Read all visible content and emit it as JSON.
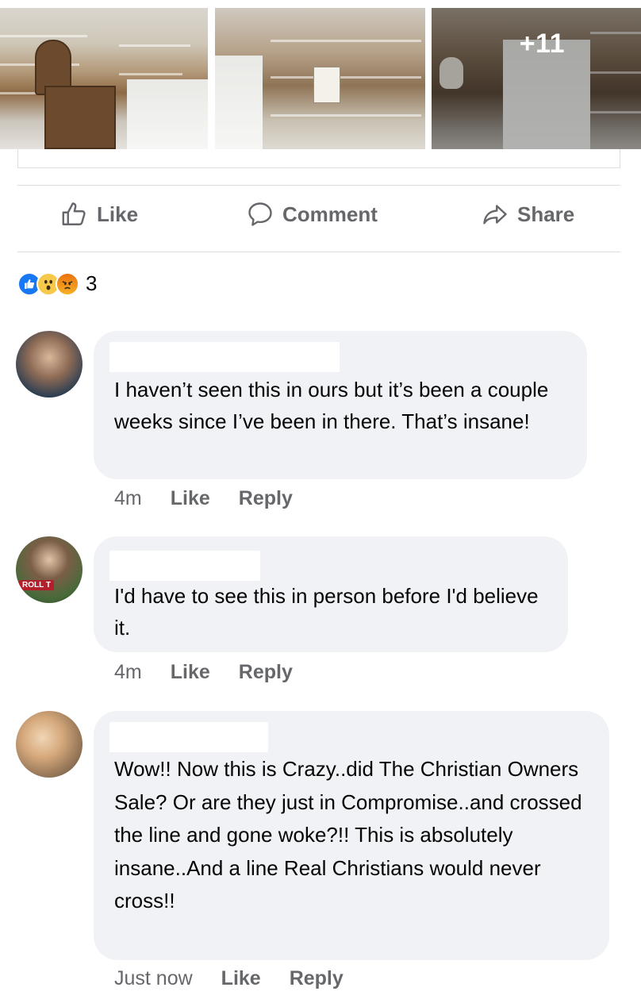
{
  "post": {
    "photos": {
      "more_count": "+11"
    },
    "actions": {
      "like_label": "Like",
      "comment_label": "Comment",
      "share_label": "Share"
    },
    "reactions": {
      "types": [
        "like",
        "wow",
        "angry"
      ],
      "count": "3"
    }
  },
  "comments": [
    {
      "text": "I haven’t seen this in ours but it’s been a couple weeks since I’ve been in there. That’s insane!",
      "time": "4m",
      "like_label": "Like",
      "reply_label": "Reply"
    },
    {
      "avatar_tag": "ROLL T",
      "text": "I'd have to see this in person before I'd believe it.",
      "time": "4m",
      "like_label": "Like",
      "reply_label": "Reply"
    },
    {
      "text": "Wow!! Now this is Crazy..did The Christian Owners Sale? Or are they just in Compromise..and crossed the line and gone woke?!! This is absolutely insane..And a line Real Christians would never cross!!",
      "time": "Just now",
      "like_label": "Like",
      "reply_label": "Reply"
    }
  ],
  "colors": {
    "accent": "#1877f2",
    "secondary_text": "#65676b",
    "bubble_bg": "#f0f2f5"
  }
}
